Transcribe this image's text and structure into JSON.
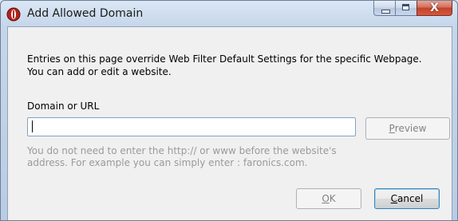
{
  "window": {
    "title": "Add Allowed Domain",
    "icon": "faronics-logo-icon"
  },
  "caption_buttons": {
    "minimize": "minimize-icon",
    "maximize": "maximize-icon",
    "close_glyph": "X"
  },
  "description": {
    "line1": "Entries on this page override Web Filter Default Settings for the specific Webpage.",
    "line2": "You can add or edit a website."
  },
  "domain_field": {
    "label": "Domain or URL",
    "value": "",
    "placeholder": ""
  },
  "preview_button": {
    "accel": "P",
    "rest": "review",
    "enabled": false
  },
  "hint": {
    "line1": "You do not need to enter the http:// or www before the website's",
    "line2": "address. For example you can simply enter : faronics.com."
  },
  "ok_button": {
    "accel": "O",
    "rest": "K",
    "enabled": false
  },
  "cancel_button": {
    "accel": "C",
    "rest": "ancel",
    "enabled": true
  },
  "colors": {
    "title_bg": "#c7d7ea",
    "client_bg": "#f0f0f0",
    "close_red": "#c2432a",
    "hint_gray": "#9a9a9a",
    "input_border": "#7ea3c9"
  }
}
